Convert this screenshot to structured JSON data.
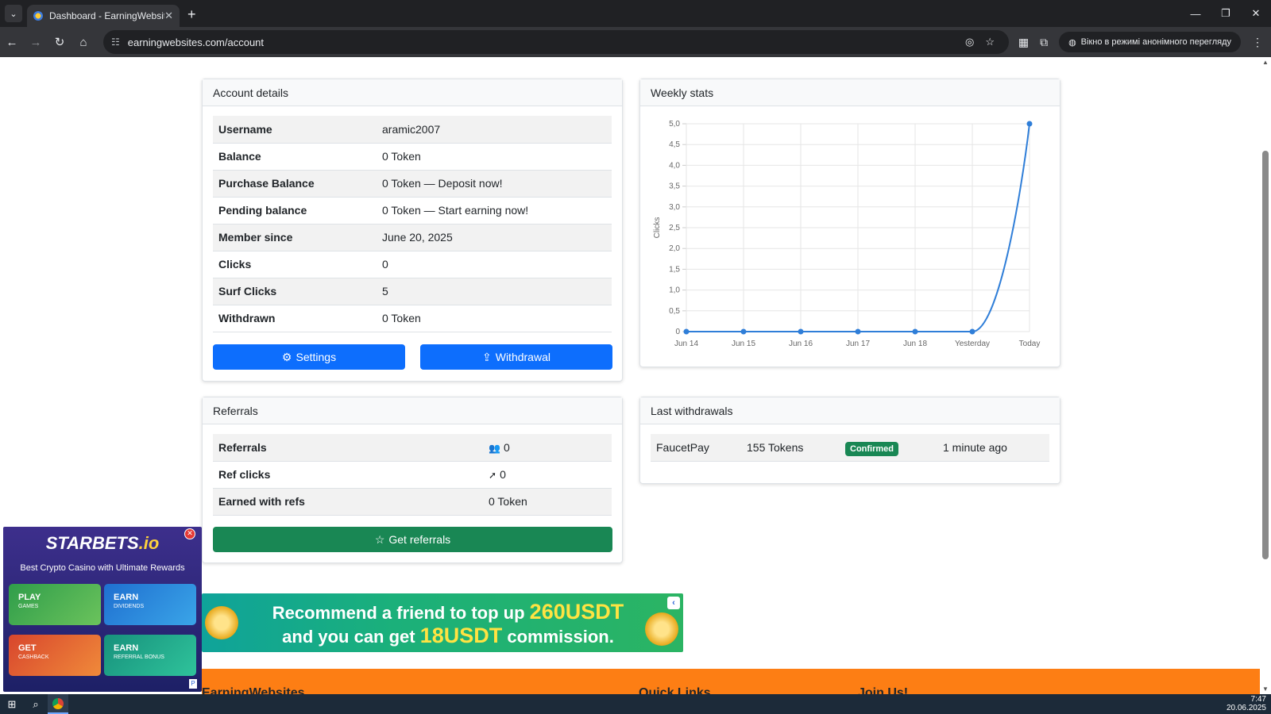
{
  "browser": {
    "tab_title": "Dashboard - EarningWebsites",
    "url": "earningwebsites.com/account",
    "incognito_label": "Вікно в режимі анонімного перегляду"
  },
  "account": {
    "header": "Account details",
    "rows": [
      {
        "label": "Username",
        "value": "aramic2007"
      },
      {
        "label": "Balance",
        "value": "0 Token"
      },
      {
        "label": "Purchase Balance",
        "value": "0 Token — Deposit now!"
      },
      {
        "label": "Pending balance",
        "value": "0 Token — Start earning now!"
      },
      {
        "label": "Member since",
        "value": "June 20, 2025"
      },
      {
        "label": "Clicks",
        "value": "0"
      },
      {
        "label": "Surf Clicks",
        "value": "5"
      },
      {
        "label": "Withdrawn",
        "value": "0 Token"
      }
    ],
    "settings_label": "Settings",
    "withdrawal_label": "Withdrawal"
  },
  "weekly": {
    "header": "Weekly stats"
  },
  "chart_data": {
    "type": "line",
    "categories": [
      "Jun 14",
      "Jun 15",
      "Jun 16",
      "Jun 17",
      "Jun 18",
      "Yesterday",
      "Today"
    ],
    "series": [
      {
        "values": [
          0,
          0,
          0,
          0,
          0,
          0,
          5
        ]
      }
    ],
    "ylabel": "Clicks",
    "ylim": [
      0,
      5
    ],
    "yticks": [
      "0",
      "0,5",
      "1,0",
      "1,5",
      "2,0",
      "2,5",
      "3,0",
      "3,5",
      "4,0",
      "4,5",
      "5,0"
    ],
    "grid": true,
    "color": "#2f7ed8"
  },
  "referrals": {
    "header": "Referrals",
    "rows": [
      {
        "label": "Referrals",
        "value": "0",
        "icon": "users-icon"
      },
      {
        "label": "Ref clicks",
        "value": "0",
        "icon": "cursor-icon"
      },
      {
        "label": "Earned with refs",
        "value": "0 Token",
        "icon": ""
      }
    ],
    "button_label": "Get referrals"
  },
  "withdrawals": {
    "header": "Last withdrawals",
    "rows": [
      {
        "method": "FaucetPay",
        "amount": "155 Tokens",
        "status": "Confirmed",
        "time": "1 minute ago"
      }
    ]
  },
  "promo_banner": {
    "line1_text": "Recommend a friend to top up ",
    "line1_highlight": "260USDT",
    "line2_text": "and you can get ",
    "line2_highlight": "18USDT",
    "line2_end": " commission."
  },
  "side_ad": {
    "logo_main": "STARBETS",
    "logo_suffix": ".io",
    "tagline": "Best Crypto Casino with Ultimate Rewards",
    "tiles": [
      {
        "title": "PLAY",
        "sub": "GAMES"
      },
      {
        "title": "EARN",
        "sub": "DIVIDENDS"
      },
      {
        "title": "GET",
        "sub": "CASHBACK"
      },
      {
        "title": "EARN",
        "sub": "REFERRAL BONUS"
      }
    ]
  },
  "footer": {
    "col1": "EarningWebsites",
    "col2": "Quick Links",
    "col3": "Join Us!"
  },
  "taskbar": {
    "time": "7:47",
    "date": "20.06.2025"
  }
}
